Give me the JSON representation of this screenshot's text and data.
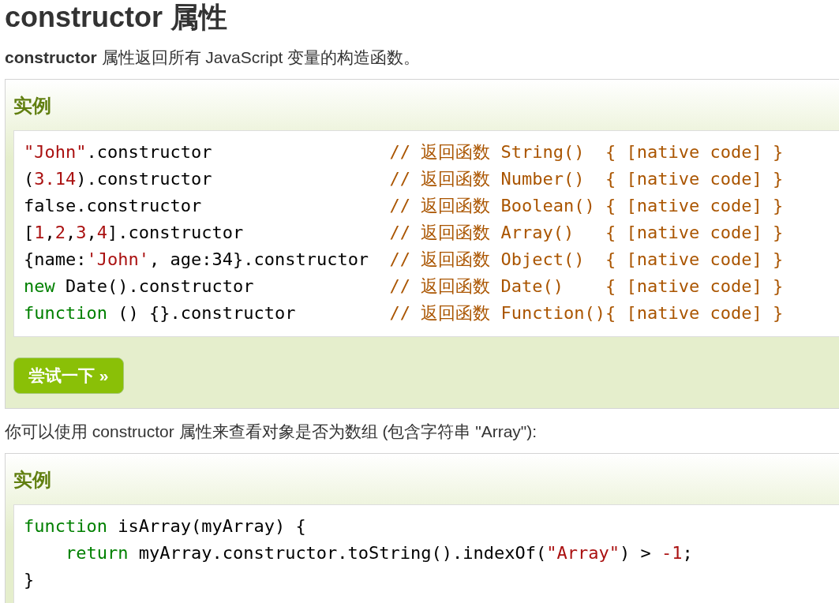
{
  "heading": "constructor 属性",
  "intro": "**constructor** 属性返回所有 JavaScript 变量的构造函数。",
  "examples": [
    {
      "title": "实例",
      "code_lines": [
        {
          "code": [
            {
              "kind": "string",
              "text": "\"John\""
            },
            {
              "kind": "plain",
              "text": ".constructor"
            }
          ],
          "comment": "// 返回函数 String()  { [native code] }"
        },
        {
          "code": [
            {
              "kind": "plain",
              "text": "("
            },
            {
              "kind": "number",
              "text": "3.14"
            },
            {
              "kind": "plain",
              "text": ").constructor"
            }
          ],
          "comment": "// 返回函数 Number()  { [native code] }"
        },
        {
          "code": [
            {
              "kind": "plain",
              "text": "false.constructor"
            }
          ],
          "comment": "// 返回函数 Boolean() { [native code] }"
        },
        {
          "code": [
            {
              "kind": "plain",
              "text": "["
            },
            {
              "kind": "number",
              "text": "1"
            },
            {
              "kind": "plain",
              "text": ","
            },
            {
              "kind": "number",
              "text": "2"
            },
            {
              "kind": "plain",
              "text": ","
            },
            {
              "kind": "number",
              "text": "3"
            },
            {
              "kind": "plain",
              "text": ","
            },
            {
              "kind": "number",
              "text": "4"
            },
            {
              "kind": "plain",
              "text": "].constructor"
            }
          ],
          "comment": "// 返回函数 Array()   { [native code] }"
        },
        {
          "code": [
            {
              "kind": "plain",
              "text": "{name:"
            },
            {
              "kind": "string",
              "text": "'John'"
            },
            {
              "kind": "plain",
              "text": ", age:34}.constructor"
            }
          ],
          "comment": "// 返回函数 Object()  { [native code] }"
        },
        {
          "code": [
            {
              "kind": "keyword",
              "text": "new"
            },
            {
              "kind": "plain",
              "text": " Date().constructor"
            }
          ],
          "comment": "// 返回函数 Date()    { [native code] }"
        },
        {
          "code": [
            {
              "kind": "keyword",
              "text": "function"
            },
            {
              "kind": "plain",
              "text": " () {}.constructor"
            }
          ],
          "comment": "// 返回函数 Function(){ [native code] }"
        }
      ],
      "button": "尝试一下 »"
    },
    {
      "title": "实例",
      "code_lines": [
        {
          "code": [
            {
              "kind": "keyword",
              "text": "function"
            },
            {
              "kind": "plain",
              "text": " isArray(myArray) {"
            }
          ]
        },
        {
          "indent": true,
          "code": [
            {
              "kind": "keyword",
              "text": "return"
            },
            {
              "kind": "plain",
              "text": " myArray.constructor.toString().indexOf("
            },
            {
              "kind": "string",
              "text": "\"Array\""
            },
            {
              "kind": "plain",
              "text": ") > "
            },
            {
              "kind": "number",
              "text": "-1"
            },
            {
              "kind": "plain",
              "text": ";"
            }
          ]
        },
        {
          "code": [
            {
              "kind": "plain",
              "text": "}"
            }
          ]
        }
      ]
    }
  ],
  "paragraphs": [
    "你可以使用 constructor 属性来查看对象是否为数组 (包含字符串 \"Array\"):"
  ]
}
